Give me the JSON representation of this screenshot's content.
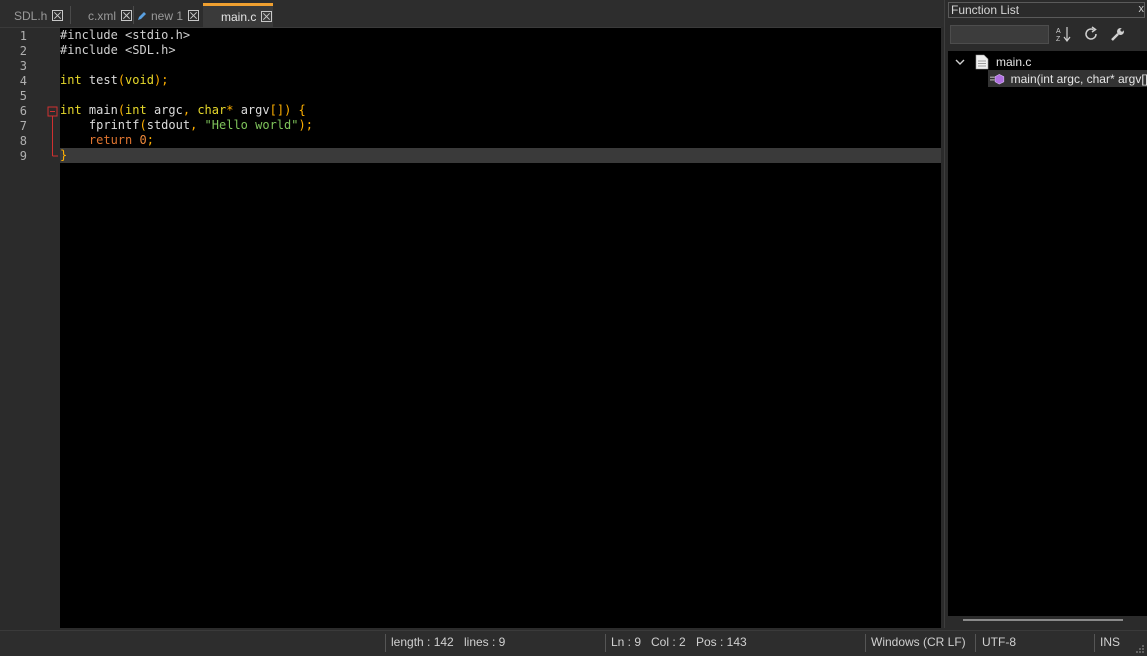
{
  "tabs": [
    {
      "label": "SDL.h",
      "active": false,
      "modified": false
    },
    {
      "label": "c.xml",
      "active": false,
      "modified": false
    },
    {
      "label": "new 1",
      "active": false,
      "modified": true
    },
    {
      "label": "main.c",
      "active": true,
      "modified": false
    }
  ],
  "editor": {
    "line_numbers": [
      "1",
      "2",
      "3",
      "4",
      "5",
      "6",
      "7",
      "8",
      "9"
    ],
    "current_line": 9,
    "lines": [
      "#include <stdio.h>",
      "#include <SDL.h>",
      "",
      "int test(void);",
      "",
      "int main(int argc, char* argv[]) {",
      "    fprintf(stdout, \"Hello world\");",
      "    return 0;",
      "}"
    ]
  },
  "function_list": {
    "title": "Function List",
    "close": "x",
    "search_value": "",
    "root": "main.c",
    "items": [
      "main(int argc, char* argv[]"
    ]
  },
  "status_bar": {
    "length": "length : 142",
    "lines": "lines : 9",
    "ln": "Ln : 9",
    "col": "Col : 2",
    "pos": "Pos : 143",
    "eol": "Windows (CR LF)",
    "encoding": "UTF-8",
    "mode": "INS"
  },
  "colors": {
    "active_tab_accent": "#f0a030",
    "editor_bg": "#000000",
    "fold_marker": "#d03030"
  }
}
